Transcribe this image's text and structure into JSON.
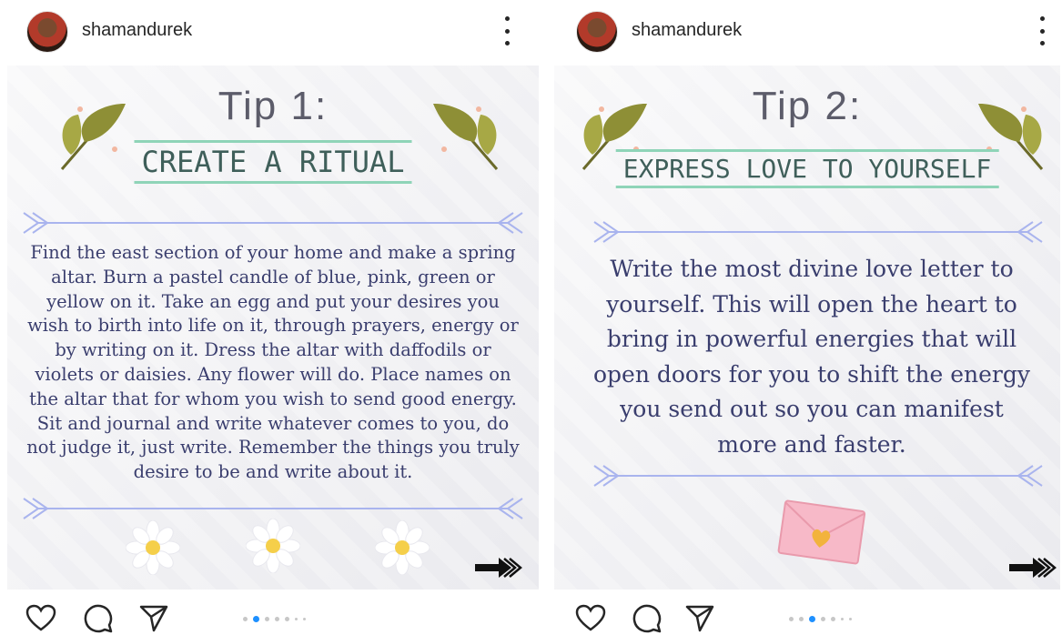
{
  "posts": [
    {
      "username": "shamandurek",
      "tip_label": "Tip 1:",
      "heading": "CREATE A RITUAL",
      "body": "Find the east section of your home and make a spring altar. Burn a pastel candle of blue, pink, green or yellow on it. Take an egg and put your desires you wish to birth into life on it, through prayers, energy or by writing on it. Dress the altar with daffodils or violets or daisies. Any flower will do. Place names on the altar that for whom you wish to send good energy. Sit and journal and write whatever comes to you, do not judge it, just write. Remember the things you truly desire to be and write about it.",
      "carousel": {
        "total": 7,
        "active": 1
      }
    },
    {
      "username": "shamandurek",
      "tip_label": "Tip 2:",
      "heading": "EXPRESS LOVE TO YOURSELF",
      "body": "Write the most divine love letter to yourself. This will open the heart to bring in powerful energies that will open doors for you to shift the energy you send out so you can manifest more and faster.",
      "carousel": {
        "total": 7,
        "active": 2
      }
    }
  ],
  "icons": {
    "like": "heart-icon",
    "comment": "comment-icon",
    "share": "send-icon",
    "more": "more-options-icon",
    "next": "next-arrow-icon"
  },
  "colors": {
    "accent_dot": "#1e90ff",
    "heading_text": "#3f5f5a",
    "heading_rule": "#8fd4b8",
    "body_text": "#3a3e6e",
    "arrow_line": "#a9b4ee"
  }
}
